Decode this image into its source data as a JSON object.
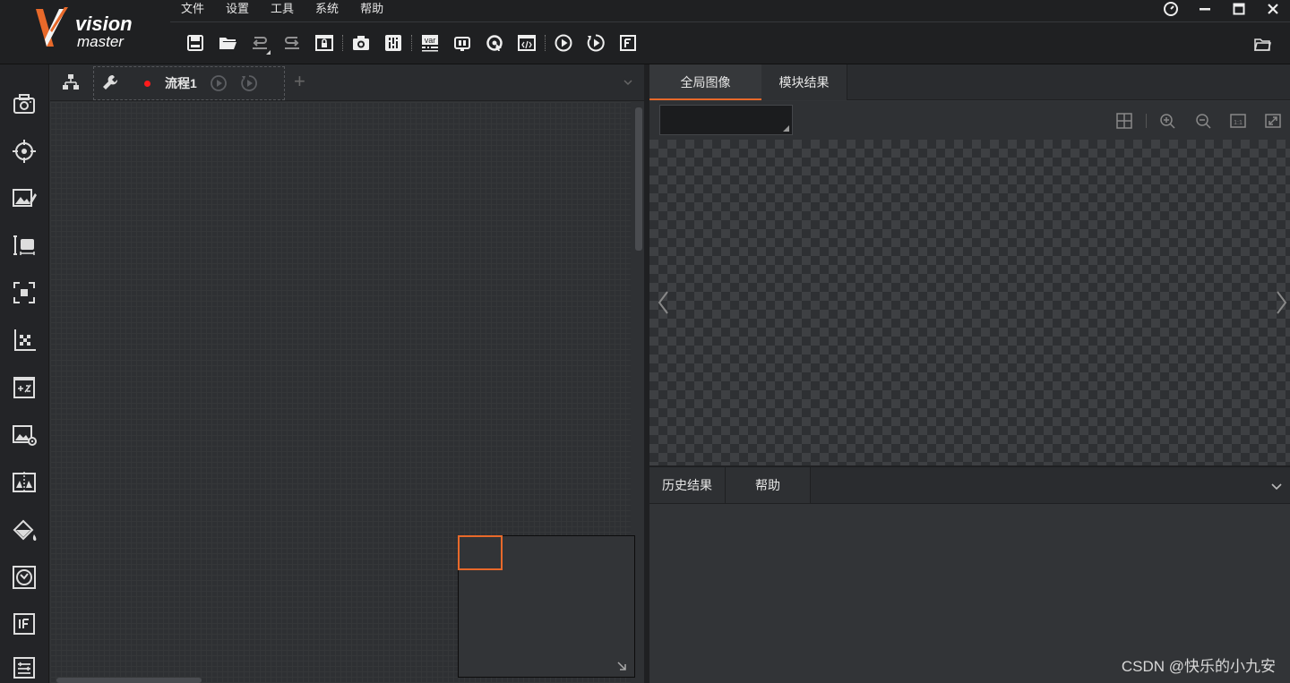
{
  "app": {
    "logo_line1": "vision",
    "logo_line2": "master"
  },
  "menu": [
    "文件",
    "设置",
    "工具",
    "系统",
    "帮助"
  ],
  "toolbar_icons": [
    "save-icon",
    "open-folder-icon",
    "undo-icon",
    "redo-icon",
    "lock-screen-icon",
    "camera-icon",
    "controller-icon",
    "variable-icon",
    "communication-icon",
    "global-trigger-icon",
    "script-icon",
    "run-once-icon",
    "run-continuous-icon",
    "frontend-icon"
  ],
  "flow": {
    "tab_label": "流程1",
    "add_label": "+"
  },
  "right": {
    "tabs": [
      "全局图像",
      "模块结果"
    ],
    "active_tab": "全局图像",
    "bottom_tabs": [
      "历史结果",
      "帮助"
    ]
  },
  "watermark": "CSDN @快乐的小九安",
  "colors": {
    "accent": "#e8692a",
    "record_dot": "#ff1b1b",
    "background": "#2b2d30"
  }
}
